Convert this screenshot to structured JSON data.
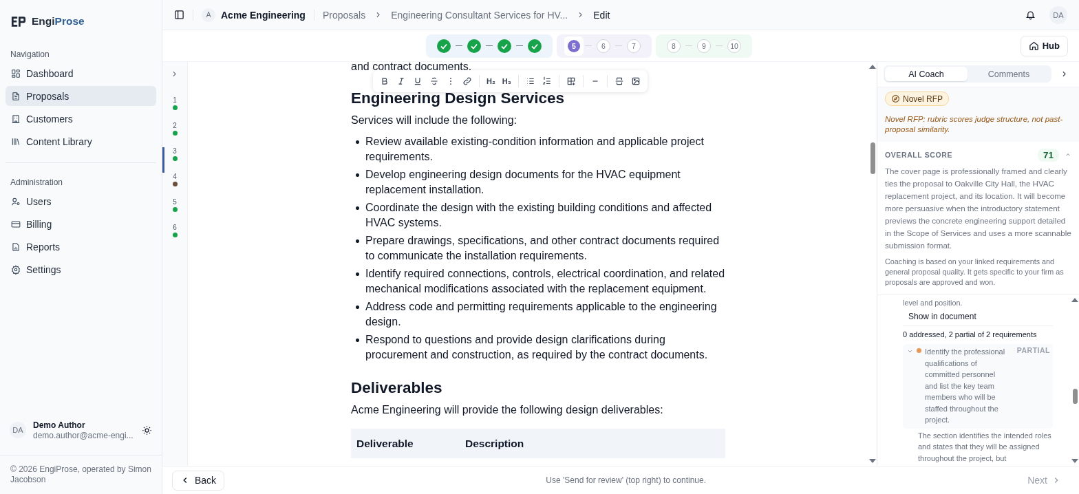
{
  "brand": {
    "first": "Engi",
    "second": "Prose"
  },
  "sidebar": {
    "sections": [
      {
        "title": "Navigation",
        "items": [
          {
            "label": "Dashboard",
            "selected": false
          },
          {
            "label": "Proposals",
            "selected": true
          },
          {
            "label": "Customers",
            "selected": false
          },
          {
            "label": "Content Library",
            "selected": false
          }
        ]
      },
      {
        "title": "Administration",
        "items": [
          {
            "label": "Users",
            "selected": false
          },
          {
            "label": "Billing",
            "selected": false
          },
          {
            "label": "Reports",
            "selected": false
          },
          {
            "label": "Settings",
            "selected": false
          }
        ]
      }
    ],
    "user": {
      "initials": "DA",
      "name": "Demo Author",
      "email": "demo.author@acme-engi..."
    },
    "copyright": "© 2026 EngiProse, operated by Simon Jacobson"
  },
  "topbar": {
    "org_initial": "A",
    "org": "Acme Engineering",
    "breadcrumbs": [
      "Proposals",
      "Engineering Consultant Services for HV...",
      "Edit"
    ],
    "user_initials": "DA"
  },
  "steps": {
    "groups": [
      {
        "color": "#eef4fb",
        "steps": [
          {
            "done": true
          },
          {
            "done": true
          },
          {
            "done": true
          },
          {
            "done": true
          }
        ]
      },
      {
        "color": "#f3f2fb",
        "steps": [
          {
            "label": "5",
            "done": false,
            "current": true
          },
          {
            "label": "6",
            "done": false,
            "current": false
          },
          {
            "label": "7",
            "done": false,
            "current": false
          }
        ]
      },
      {
        "color": "#eefaf3",
        "steps": [
          {
            "label": "8",
            "done": false,
            "current": false
          },
          {
            "label": "9",
            "done": false,
            "current": false
          },
          {
            "label": "10",
            "done": false,
            "current": false
          }
        ]
      }
    ]
  },
  "hub_button": "Hub",
  "outline": [
    {
      "number": "1",
      "color": "#16a34a",
      "selected": false
    },
    {
      "number": "2",
      "color": "#16a34a",
      "selected": false
    },
    {
      "number": "3",
      "color": "#16a34a",
      "selected": true
    },
    {
      "number": "4",
      "color": "#6b4f3a",
      "selected": false
    },
    {
      "number": "5",
      "color": "#16a34a",
      "selected": false
    },
    {
      "number": "6",
      "color": "#16a34a",
      "selected": false
    }
  ],
  "toolbar": {
    "heading_buttons": [
      "H₂",
      "H₃"
    ]
  },
  "document": [
    {
      "kind": "paragraph",
      "text": "and contract documents."
    },
    {
      "kind": "heading",
      "text": "Engineering Design Services"
    },
    {
      "kind": "paragraph",
      "text": "Services will include the following:"
    },
    {
      "kind": "list",
      "items": [
        "Review available existing-condition information and applicable project requirements.",
        "Develop engineering design documents for the HVAC equipment replacement installation.",
        "Coordinate the design with the existing building conditions and affected HVAC systems.",
        "Prepare drawings, specifications, and other contract documents required to communicate the installation requirements.",
        "Identify required connections, controls, electrical coordination, and related mechanical modifications associated with the replacement equipment.",
        "Address code and permitting requirements applicable to the engineering design.",
        "Respond to questions and provide design clarifications during procurement and construction, as required by the contract documents."
      ]
    },
    {
      "kind": "heading",
      "text": "Deliverables"
    },
    {
      "kind": "paragraph",
      "text": "Acme Engineering will provide the following design deliverables:"
    },
    {
      "kind": "table",
      "columns": [
        "Deliverable",
        "Description"
      ]
    }
  ],
  "coach": {
    "tabs": [
      {
        "label": "AI Coach",
        "selected": true
      },
      {
        "label": "Comments",
        "selected": false
      }
    ],
    "badge": "Novel RFP",
    "note": "Novel RFP: rubric scores judge structure, not past-proposal similarity.",
    "score_label": "OVERALL SCORE",
    "score": "71",
    "expanded": true,
    "summary": "The cover page is professionally framed and clearly ties the proposal to Oakville City Hall, the HVAC replacement project, and its location. It will become more persuasive when the introductory statement previews the concrete engineering support detailed in the Scope of Services and uses a more scannable submission format.",
    "disclaimer": "Coaching is based on your linked requirements and general proposal quality. It gets specific to your firm as proposals are approved and won.",
    "cut_text": "level and position.",
    "show_link": "Show in document",
    "requirements_summary": "0 addressed, 2 partial of 2 requirements",
    "requirements": [
      {
        "text": "Identify the professional qualifications of committed personnel and list the key team members who will be staffed throughout the project.",
        "status": "PARTIAL",
        "color": "#e59a5b",
        "expanded": true,
        "explanation": "The section identifies the intended roles and states that they will be assigned throughout the project, but"
      }
    ]
  },
  "bottom_bar": {
    "back": "Back",
    "hint": "Use 'Send for review' (top right) to continue.",
    "next": {
      "label": "Next",
      "disabled": true
    }
  }
}
